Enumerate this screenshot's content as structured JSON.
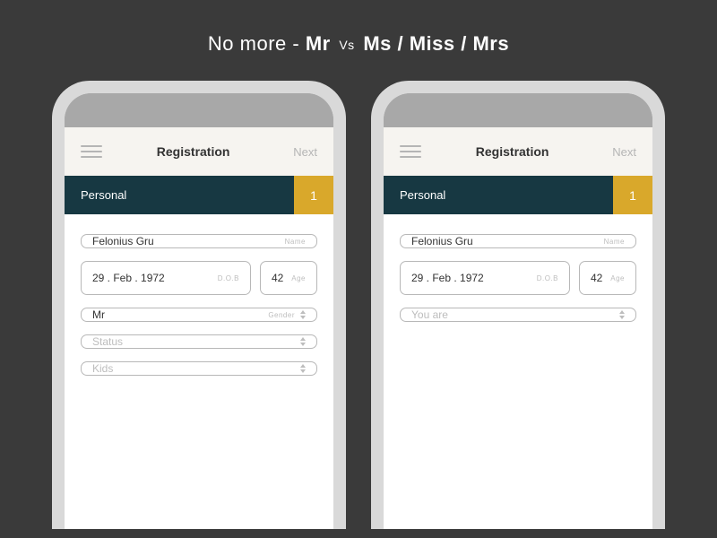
{
  "headline": {
    "prefix": "No more - ",
    "left": "Mr",
    "vs": "Vs",
    "right": "Ms / Miss / Mrs"
  },
  "phones": [
    {
      "topbar": {
        "title": "Registration",
        "next": "Next"
      },
      "section": {
        "label": "Personal",
        "step": "1"
      },
      "fields": {
        "name": {
          "value": "Felonius Gru",
          "label": "Name"
        },
        "dob": {
          "value": "29 . Feb . 1972",
          "label": "D.O.B"
        },
        "age": {
          "value": "42",
          "label": "Age"
        },
        "gender": {
          "value": "Mr",
          "label": "Gender"
        },
        "status": {
          "placeholder": "Status"
        },
        "kids": {
          "placeholder": "Kids"
        }
      }
    },
    {
      "topbar": {
        "title": "Registration",
        "next": "Next"
      },
      "section": {
        "label": "Personal",
        "step": "1"
      },
      "fields": {
        "name": {
          "value": "Felonius Gru",
          "label": "Name"
        },
        "dob": {
          "value": "29 . Feb . 1972",
          "label": "D.O.B"
        },
        "age": {
          "value": "42",
          "label": "Age"
        },
        "youare": {
          "placeholder": "You are"
        }
      }
    }
  ]
}
